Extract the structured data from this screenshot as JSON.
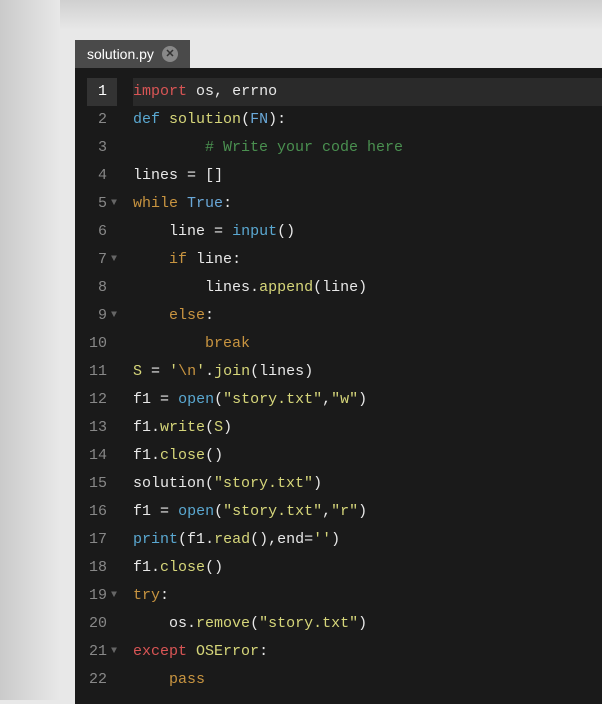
{
  "tab": {
    "filename": "solution.py",
    "close_label": "✕"
  },
  "code": {
    "lines": [
      {
        "num": "1",
        "active": true,
        "fold": false,
        "tokens": [
          {
            "cls": "tk-keyword",
            "t": "import"
          },
          {
            "cls": "tk-text",
            "t": " os"
          },
          {
            "cls": "tk-punct",
            "t": ","
          },
          {
            "cls": "tk-text",
            "t": " errno"
          }
        ]
      },
      {
        "num": "2",
        "fold": false,
        "tokens": [
          {
            "cls": "tk-def",
            "t": "def"
          },
          {
            "cls": "tk-text",
            "t": " "
          },
          {
            "cls": "tk-funcname",
            "t": "solution"
          },
          {
            "cls": "tk-punct",
            "t": "("
          },
          {
            "cls": "tk-param",
            "t": "FN"
          },
          {
            "cls": "tk-punct",
            "t": "):"
          }
        ]
      },
      {
        "num": "3",
        "fold": false,
        "tokens": [
          {
            "cls": "tk-text",
            "t": "        "
          },
          {
            "cls": "tk-comment",
            "t": "# Write your code here"
          }
        ]
      },
      {
        "num": "4",
        "fold": false,
        "tokens": [
          {
            "cls": "tk-text",
            "t": "lines "
          },
          {
            "cls": "tk-op",
            "t": "="
          },
          {
            "cls": "tk-text",
            "t": " "
          },
          {
            "cls": "tk-punct",
            "t": "[]"
          }
        ]
      },
      {
        "num": "5",
        "fold": true,
        "tokens": [
          {
            "cls": "tk-keyword2",
            "t": "while"
          },
          {
            "cls": "tk-text",
            "t": " "
          },
          {
            "cls": "tk-bool",
            "t": "True"
          },
          {
            "cls": "tk-punct",
            "t": ":"
          }
        ]
      },
      {
        "num": "6",
        "fold": false,
        "tokens": [
          {
            "cls": "tk-text",
            "t": "    line "
          },
          {
            "cls": "tk-op",
            "t": "="
          },
          {
            "cls": "tk-text",
            "t": " "
          },
          {
            "cls": "tk-func",
            "t": "input"
          },
          {
            "cls": "tk-punct",
            "t": "()"
          }
        ]
      },
      {
        "num": "7",
        "fold": true,
        "tokens": [
          {
            "cls": "tk-text",
            "t": "    "
          },
          {
            "cls": "tk-keyword2",
            "t": "if"
          },
          {
            "cls": "tk-text",
            "t": " line"
          },
          {
            "cls": "tk-punct",
            "t": ":"
          }
        ]
      },
      {
        "num": "8",
        "fold": false,
        "tokens": [
          {
            "cls": "tk-text",
            "t": "        lines"
          },
          {
            "cls": "tk-punct",
            "t": "."
          },
          {
            "cls": "tk-method",
            "t": "append"
          },
          {
            "cls": "tk-punct",
            "t": "("
          },
          {
            "cls": "tk-text",
            "t": "line"
          },
          {
            "cls": "tk-punct",
            "t": ")"
          }
        ]
      },
      {
        "num": "9",
        "fold": true,
        "tokens": [
          {
            "cls": "tk-text",
            "t": "    "
          },
          {
            "cls": "tk-keyword2",
            "t": "else"
          },
          {
            "cls": "tk-punct",
            "t": ":"
          }
        ]
      },
      {
        "num": "10",
        "fold": false,
        "tokens": [
          {
            "cls": "tk-text",
            "t": "        "
          },
          {
            "cls": "tk-keyword2",
            "t": "break"
          }
        ]
      },
      {
        "num": "11",
        "fold": false,
        "tokens": [
          {
            "cls": "tk-var",
            "t": "S"
          },
          {
            "cls": "tk-text",
            "t": " "
          },
          {
            "cls": "tk-op",
            "t": "="
          },
          {
            "cls": "tk-text",
            "t": " "
          },
          {
            "cls": "tk-string",
            "t": "'"
          },
          {
            "cls": "tk-escape",
            "t": "\\n"
          },
          {
            "cls": "tk-string",
            "t": "'"
          },
          {
            "cls": "tk-punct",
            "t": "."
          },
          {
            "cls": "tk-method",
            "t": "join"
          },
          {
            "cls": "tk-punct",
            "t": "("
          },
          {
            "cls": "tk-text",
            "t": "lines"
          },
          {
            "cls": "tk-punct",
            "t": ")"
          }
        ]
      },
      {
        "num": "12",
        "fold": false,
        "tokens": [
          {
            "cls": "tk-text",
            "t": "f1 "
          },
          {
            "cls": "tk-op",
            "t": "="
          },
          {
            "cls": "tk-text",
            "t": " "
          },
          {
            "cls": "tk-func",
            "t": "open"
          },
          {
            "cls": "tk-punct",
            "t": "("
          },
          {
            "cls": "tk-string",
            "t": "\"story.txt\""
          },
          {
            "cls": "tk-punct",
            "t": ","
          },
          {
            "cls": "tk-string",
            "t": "\"w\""
          },
          {
            "cls": "tk-punct",
            "t": ")"
          }
        ]
      },
      {
        "num": "13",
        "fold": false,
        "tokens": [
          {
            "cls": "tk-text",
            "t": "f1"
          },
          {
            "cls": "tk-punct",
            "t": "."
          },
          {
            "cls": "tk-method",
            "t": "write"
          },
          {
            "cls": "tk-punct",
            "t": "("
          },
          {
            "cls": "tk-var",
            "t": "S"
          },
          {
            "cls": "tk-punct",
            "t": ")"
          }
        ]
      },
      {
        "num": "14",
        "fold": false,
        "tokens": [
          {
            "cls": "tk-text",
            "t": "f1"
          },
          {
            "cls": "tk-punct",
            "t": "."
          },
          {
            "cls": "tk-method",
            "t": "close"
          },
          {
            "cls": "tk-punct",
            "t": "()"
          }
        ]
      },
      {
        "num": "15",
        "fold": false,
        "tokens": [
          {
            "cls": "tk-text",
            "t": "solution"
          },
          {
            "cls": "tk-punct",
            "t": "("
          },
          {
            "cls": "tk-string",
            "t": "\"story.txt\""
          },
          {
            "cls": "tk-punct",
            "t": ")"
          }
        ]
      },
      {
        "num": "16",
        "fold": false,
        "tokens": [
          {
            "cls": "tk-text",
            "t": "f1 "
          },
          {
            "cls": "tk-op",
            "t": "="
          },
          {
            "cls": "tk-text",
            "t": " "
          },
          {
            "cls": "tk-func",
            "t": "open"
          },
          {
            "cls": "tk-punct",
            "t": "("
          },
          {
            "cls": "tk-string",
            "t": "\"story.txt\""
          },
          {
            "cls": "tk-punct",
            "t": ","
          },
          {
            "cls": "tk-string",
            "t": "\"r\""
          },
          {
            "cls": "tk-punct",
            "t": ")"
          }
        ]
      },
      {
        "num": "17",
        "fold": false,
        "tokens": [
          {
            "cls": "tk-func",
            "t": "print"
          },
          {
            "cls": "tk-punct",
            "t": "("
          },
          {
            "cls": "tk-text",
            "t": "f1"
          },
          {
            "cls": "tk-punct",
            "t": "."
          },
          {
            "cls": "tk-method",
            "t": "read"
          },
          {
            "cls": "tk-punct",
            "t": "(),"
          },
          {
            "cls": "tk-text",
            "t": "end"
          },
          {
            "cls": "tk-op",
            "t": "="
          },
          {
            "cls": "tk-string",
            "t": "''"
          },
          {
            "cls": "tk-punct",
            "t": ")"
          }
        ]
      },
      {
        "num": "18",
        "fold": false,
        "tokens": [
          {
            "cls": "tk-text",
            "t": "f1"
          },
          {
            "cls": "tk-punct",
            "t": "."
          },
          {
            "cls": "tk-method",
            "t": "close"
          },
          {
            "cls": "tk-punct",
            "t": "()"
          }
        ]
      },
      {
        "num": "19",
        "fold": true,
        "tokens": [
          {
            "cls": "tk-keyword2",
            "t": "try"
          },
          {
            "cls": "tk-punct",
            "t": ":"
          }
        ]
      },
      {
        "num": "20",
        "fold": false,
        "tokens": [
          {
            "cls": "tk-text",
            "t": "    os"
          },
          {
            "cls": "tk-punct",
            "t": "."
          },
          {
            "cls": "tk-method",
            "t": "remove"
          },
          {
            "cls": "tk-punct",
            "t": "("
          },
          {
            "cls": "tk-string",
            "t": "\"story.txt\""
          },
          {
            "cls": "tk-punct",
            "t": ")"
          }
        ]
      },
      {
        "num": "21",
        "fold": true,
        "tokens": [
          {
            "cls": "tk-keyword",
            "t": "except"
          },
          {
            "cls": "tk-text",
            "t": " "
          },
          {
            "cls": "tk-var",
            "t": "OSError"
          },
          {
            "cls": "tk-punct",
            "t": ":"
          }
        ]
      },
      {
        "num": "22",
        "fold": false,
        "tokens": [
          {
            "cls": "tk-text",
            "t": "    "
          },
          {
            "cls": "tk-keyword2",
            "t": "pass"
          }
        ]
      }
    ]
  }
}
